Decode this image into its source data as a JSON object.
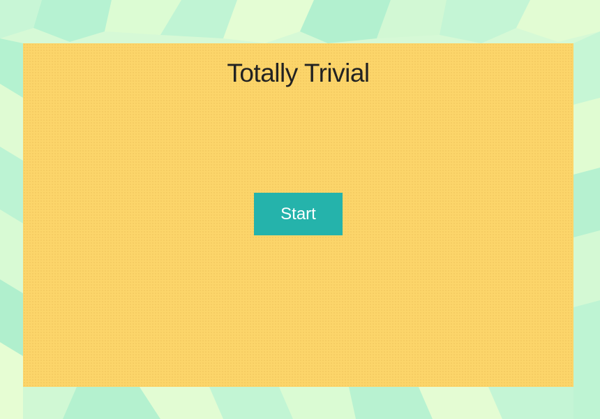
{
  "app": {
    "title": "Totally Trivial"
  },
  "actions": {
    "start_label": "Start"
  },
  "colors": {
    "panel": "#fcd56a",
    "button": "#25b3ab",
    "button_text": "#ffffff",
    "title_text": "#222222",
    "background_light": "#e6fdd2",
    "background_mint": "#b4f5d0"
  }
}
